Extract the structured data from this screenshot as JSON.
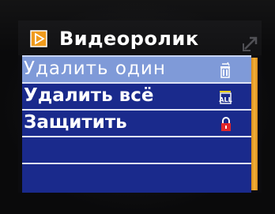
{
  "screen": {
    "title": "Видеоролик",
    "title_icon": "play-icon",
    "corner_icon": "return-arrow-icon"
  },
  "menu": {
    "items": [
      {
        "label": "Удалить один",
        "icon": "delete-one-icon",
        "selected": true
      },
      {
        "label": "Удалить всё",
        "icon": "delete-all-icon",
        "icon_text": "ALL",
        "selected": false
      },
      {
        "label": "Защитить",
        "icon": "lock-icon",
        "selected": false
      },
      {
        "label": "",
        "selected": false
      },
      {
        "label": "",
        "selected": false
      }
    ]
  },
  "colors": {
    "menu_background": "#1a2a8c",
    "selected_row": "#7f9ad8",
    "scrollbar_thumb": "#f3b13a",
    "lock_icon": "#e0262a",
    "title_icon": "#f09a1a"
  }
}
